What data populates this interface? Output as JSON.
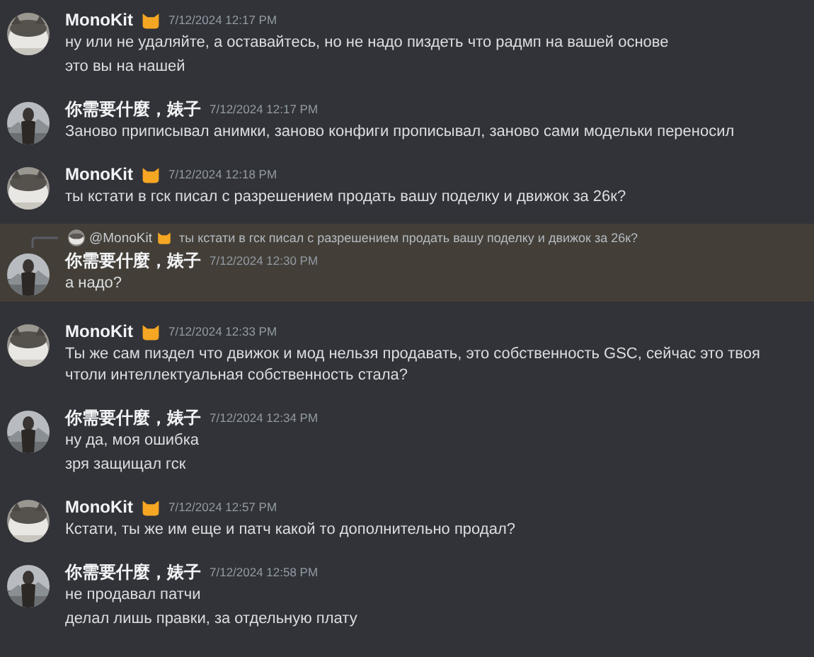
{
  "messages": [
    {
      "kind": "first_user",
      "author": "MonoKit",
      "badge": true,
      "time": "7/12/2024 12:17 PM",
      "highlighted": false,
      "lines": [
        "ну или не удаляйте, а оставайтесь, но не надо пиздеть что радмп на вашей основе",
        "это вы на нашей"
      ]
    },
    {
      "kind": "second_user",
      "author": "你需要什麼，婊子",
      "badge": false,
      "time": "7/12/2024 12:17 PM",
      "highlighted": false,
      "lines": [
        "Заново приписывал анимки, заново конфиги прописывал, заново сами модельки переносил"
      ]
    },
    {
      "kind": "first_user",
      "author": "MonoKit",
      "badge": true,
      "time": "7/12/2024 12:18 PM",
      "highlighted": false,
      "lines": [
        "ты кстати в гск писал с разрешением продать вашу поделку и движок за 26к?"
      ]
    },
    {
      "kind": "second_user",
      "author": "你需要什麼，婊子",
      "badge": false,
      "time": "7/12/2024 12:30 PM",
      "highlighted": true,
      "reply": {
        "author": "@MonoKit",
        "badge": true,
        "text": "ты кстати в гск писал с разрешением продать вашу поделку и движок за 26к?"
      },
      "lines": [
        "а надо?"
      ]
    },
    {
      "kind": "first_user",
      "author": "MonoKit",
      "badge": true,
      "time": "7/12/2024 12:33 PM",
      "highlighted": false,
      "lines": [
        "Ты же сам пиздел что движок и мод нельзя продавать, это собственность GSC, сейчас это твоя чтоли интеллектуальная собственность стала?"
      ]
    },
    {
      "kind": "second_user",
      "author": "你需要什麼，婊子",
      "badge": false,
      "time": "7/12/2024 12:34 PM",
      "highlighted": false,
      "lines": [
        "ну да, моя ошибка",
        "зря защищал гск"
      ]
    },
    {
      "kind": "first_user",
      "author": "MonoKit",
      "badge": true,
      "time": "7/12/2024 12:57 PM",
      "highlighted": false,
      "lines": [
        "Кстати, ты же им еще и патч какой то дополнительно продал?"
      ]
    },
    {
      "kind": "second_user",
      "author": "你需要什麼，婊子",
      "badge": false,
      "time": "7/12/2024 12:58 PM",
      "highlighted": false,
      "lines": [
        "не продавал патчи",
        "делал лишь правки, за отдельную плату"
      ]
    }
  ]
}
